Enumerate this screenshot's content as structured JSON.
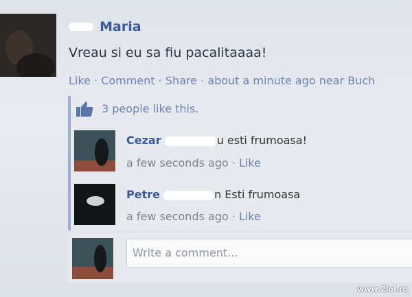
{
  "post": {
    "author_name": "Maria",
    "text": "Vreau si eu sa fiu pacalitaaaa!",
    "actions": {
      "like": "Like",
      "comment": "Comment",
      "share": "Share",
      "time": "about a minute ago near Buch"
    }
  },
  "likes": {
    "text": "3 people like this."
  },
  "comments": [
    {
      "name": "Cezar",
      "text": "u esti frumoasa!",
      "time": "a few seconds ago",
      "like": "Like"
    },
    {
      "name": "Petre",
      "text": "n Esti frumoasa",
      "time": "a few seconds ago",
      "like": "Like"
    }
  ],
  "composer": {
    "placeholder": "Write a comment..."
  },
  "watermark": "www.2lol.ro",
  "colors": {
    "name": "#3b5998",
    "link": "#6d84b4",
    "thread": "#9aaed0"
  }
}
